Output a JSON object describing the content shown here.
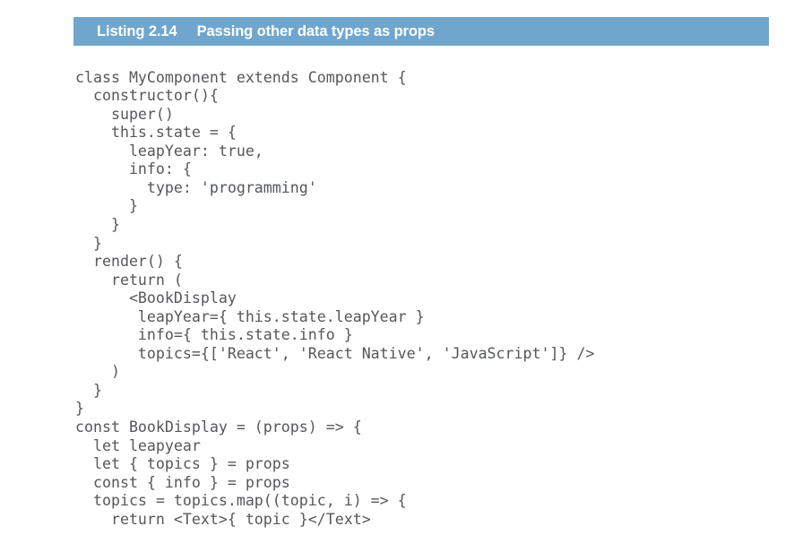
{
  "figure": {
    "kind": "code-listing",
    "caption": {
      "label": "Listing 2.14",
      "title": "Passing other data types as props",
      "bar_color": "#70a6cd",
      "text_color": "#ffffff"
    },
    "code": {
      "language": "jsx",
      "text_color": "#55575a",
      "background": "#ffffff",
      "lines": [
        "class MyComponent extends Component {",
        "  constructor(){",
        "    super()",
        "    this.state = {",
        "      leapYear: true,",
        "      info: {",
        "        type: 'programming'",
        "      }",
        "    }",
        "  }",
        "  render() {",
        "    return (",
        "      <BookDisplay",
        "       leapYear={ this.state.leapYear }",
        "       info={ this.state.info }",
        "       topics={['React', 'React Native', 'JavaScript']} />",
        "    )",
        "  }",
        "}",
        "const BookDisplay = (props) => {",
        "  let leapyear",
        "  let { topics } = props",
        "  const { info } = props",
        "  topics = topics.map((topic, i) => {",
        "    return <Text>{ topic }</Text>"
      ]
    }
  }
}
